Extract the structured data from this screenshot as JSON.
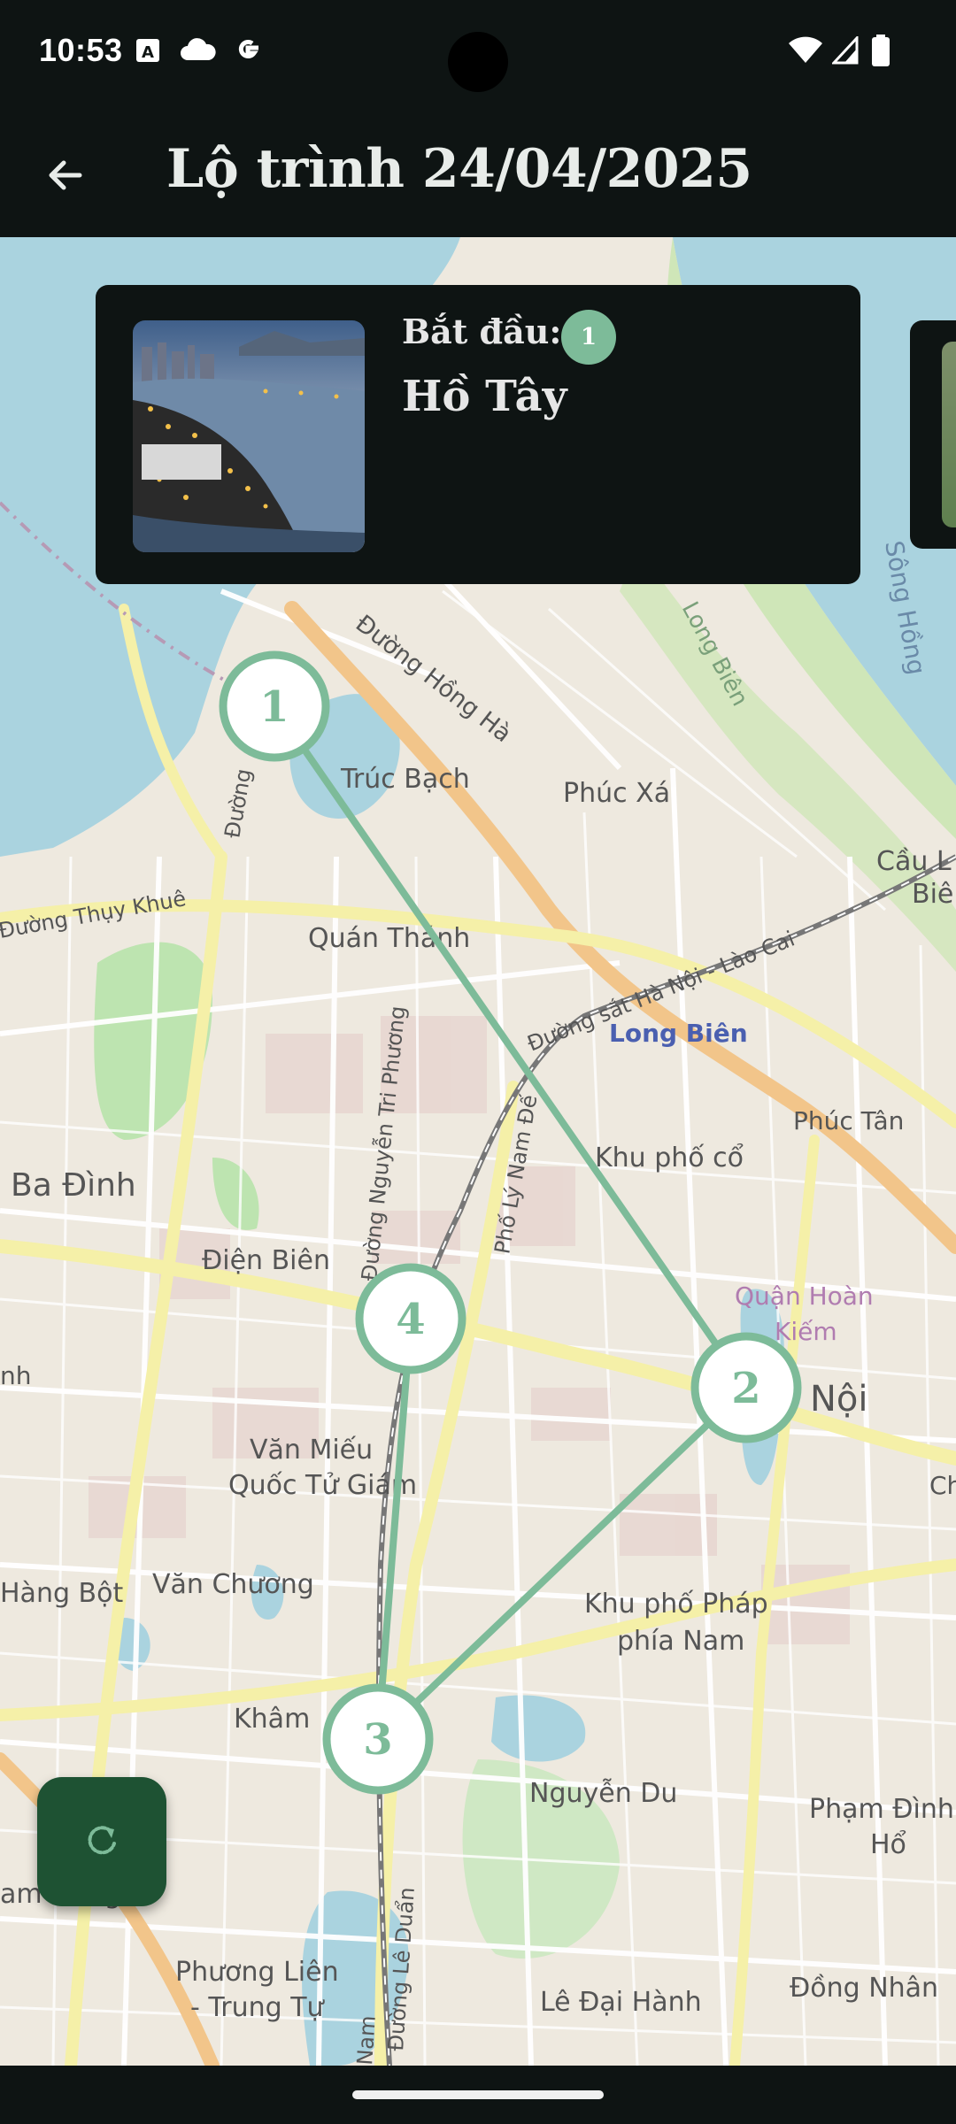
{
  "status_bar": {
    "time": "10:53",
    "icons": [
      "a-badge-icon",
      "cloud-icon",
      "google-icon",
      "wifi-icon",
      "signal-icon",
      "battery-icon"
    ]
  },
  "app_bar": {
    "title": "Lộ trình 24/04/2025",
    "back_icon": "arrow-back-icon"
  },
  "card": {
    "start_label": "Bắt đầu:",
    "badge": "1",
    "place": "Hồ Tây"
  },
  "map": {
    "labels": {
      "duong_hong_ha": "Đường Hồng Hà",
      "truc_bach": "Trúc Bạch",
      "phuc_xa": "Phúc Xá",
      "long_bien_river": "Long Biên",
      "song_hong": "Sông Hồng",
      "cau_l": "Cầu L",
      "bie": "Biê",
      "duong_thuy_khue": "Đường Thụy Khuê",
      "duong": "Đường",
      "quan_thanh": "Quán Thánh",
      "duong_sat": "Đường sắt Hà Nội - Lào Cai",
      "long_bien": "Long Biên",
      "phuc_tan": "Phúc Tân",
      "ba_dinh": "Ba Đình",
      "duong_nguyen_tri_phuong": "Đường Nguyễn Tri Phương",
      "pho_ly_nam_de": "Phố Lý Nam Đế",
      "khu_pho_co": "Khu phố cổ",
      "dien_bien": "Điện Biên",
      "quan_hoan_kiem_1": "Quận Hoàn",
      "quan_hoan_kiem_2": "Kiếm",
      "noi": "Nội",
      "ch": "Ch",
      "nh": "nh",
      "van_mieu_1": "Văn Miếu",
      "van_mieu_2": "Quốc Tử Giám",
      "hang_bot": "Hàng Bột",
      "van_chuong": "Văn Chương",
      "khu_pho_phap_1": "Khu phố Pháp",
      "khu_pho_phap_2": "phía Nam",
      "kham": "Khâm",
      "nguyen_du": "Nguyễn Du",
      "pham_dinh_ho_1": "Phạm Đình",
      "pham_dinh_ho_2": "Hổ",
      "am_dong": "am Đồng",
      "phuong_lien_1": "Phương Liên",
      "phuong_lien_2": "- Trung Tự",
      "duong_le_duan": "Đường Lê Duẩn",
      "nam": "Nam",
      "le_dai_hanh": "Lê Đại Hành",
      "dong_nhan": "Đồng Nhân"
    },
    "markers": [
      {
        "label": "1"
      },
      {
        "label": "2"
      },
      {
        "label": "3"
      },
      {
        "label": "4"
      }
    ],
    "colors": {
      "route": "#7dbb99",
      "water": "#aad3df",
      "land": "#eee9df",
      "park": "#bde4b0"
    }
  },
  "fab": {
    "icon": "refresh-icon"
  }
}
